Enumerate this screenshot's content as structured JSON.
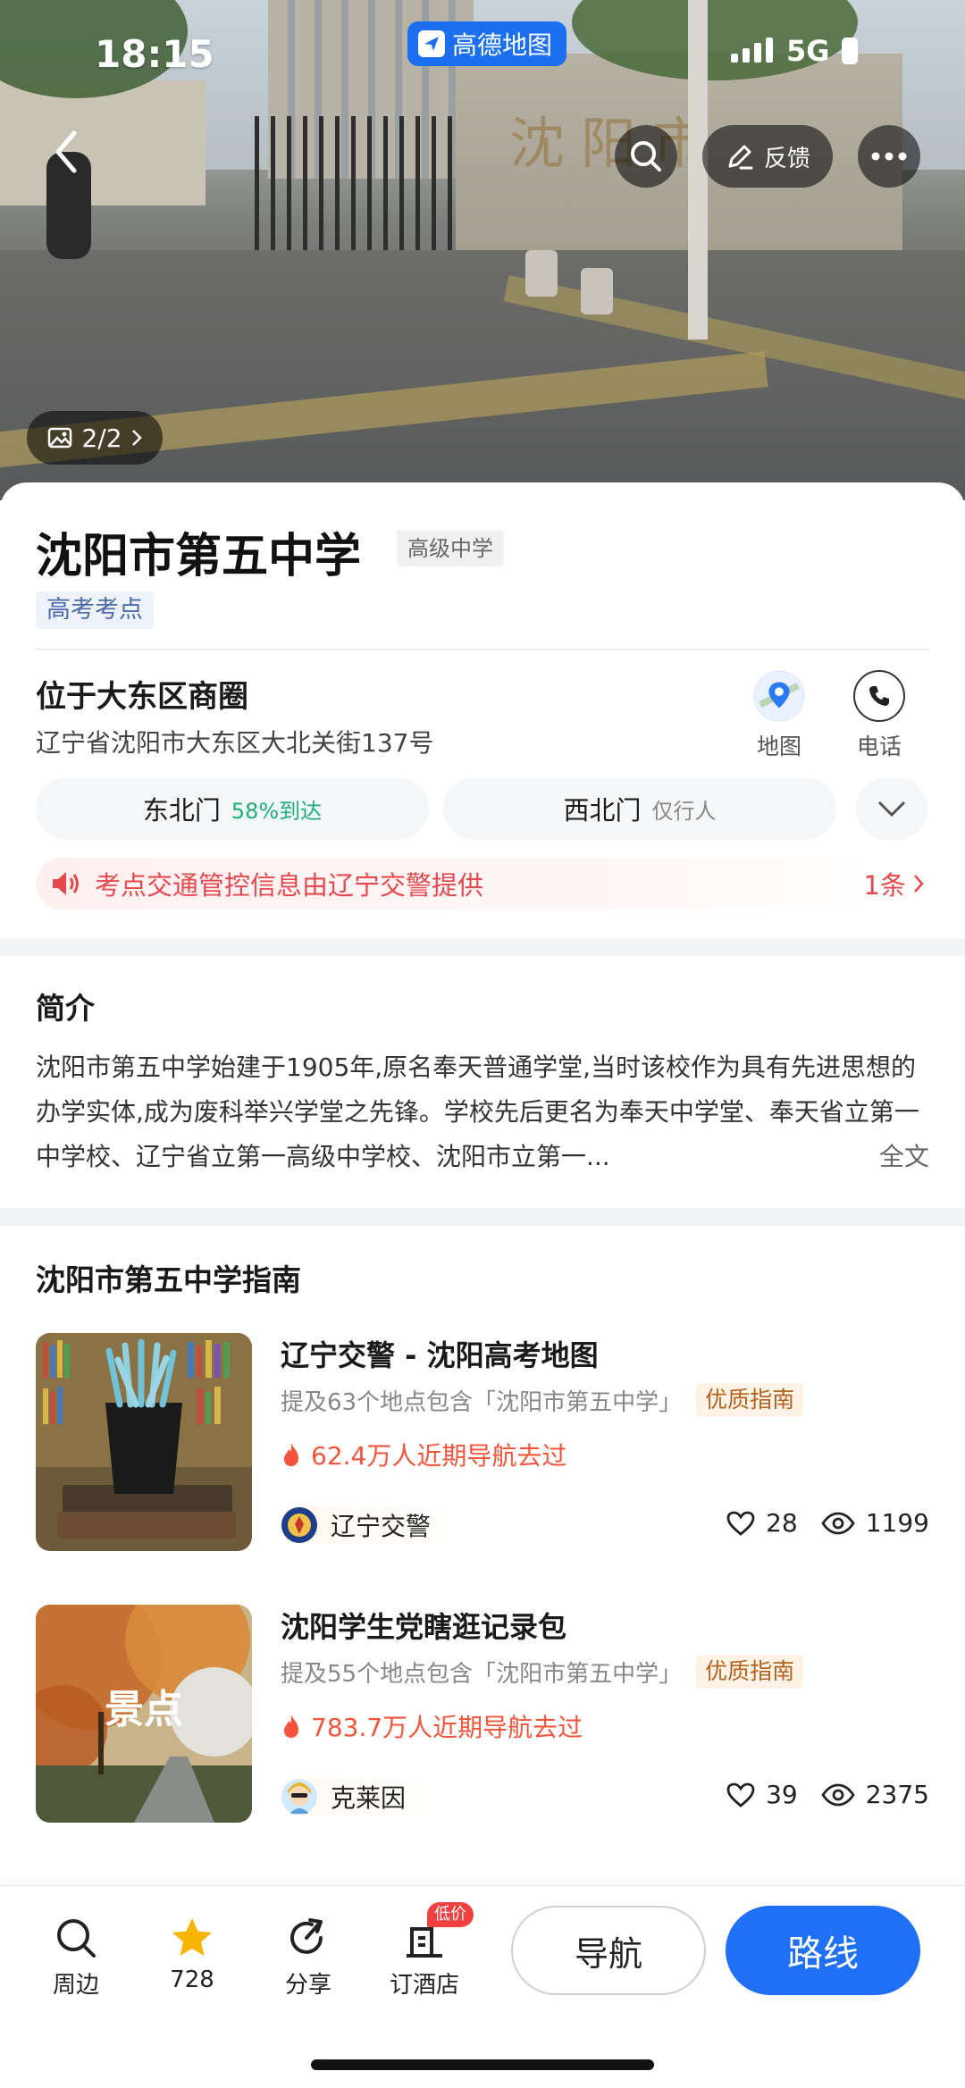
{
  "status_bar": {
    "time": "18:15",
    "network": "5G",
    "app_badge": "高德地图"
  },
  "hero": {
    "feedback_label": "反馈",
    "photo_count": "2/2",
    "sign_text": "沈阳市"
  },
  "poi": {
    "name": "沈阳市第五中学",
    "type_tag": "高级中学",
    "exam_tag": "高考考点",
    "area": "位于大东区商圈",
    "address": "辽宁省沈阳市大东区大北关街137号",
    "actions": [
      {
        "label": "地图",
        "icon": "map-pin-icon"
      },
      {
        "label": "电话",
        "icon": "phone-icon"
      }
    ],
    "gates": [
      {
        "name": "东北门",
        "note": "58%到达"
      },
      {
        "name": "西北门",
        "note": "仅行人"
      }
    ],
    "notice": {
      "text": "考点交通管控信息由辽宁交警提供",
      "count": "1条"
    }
  },
  "intro": {
    "title": "简介",
    "text": "沈阳市第五中学始建于1905年,原名奉天普通学堂,当时该校作为具有先进思想的办学实体,成为废科举兴学堂之先锋。学校先后更名为奉天中学堂、奉天省立第一中学校、辽宁省立第一高级中学校、沈阳市立第一...",
    "more": "全文"
  },
  "guides": {
    "title": "沈阳市第五中学指南",
    "items": [
      {
        "title": "辽宁交警 - 沈阳高考地图",
        "mention": "提及63个地点包含「沈阳市第五中学」",
        "quality": "优质指南",
        "hot": "62.4万人近期导航去过",
        "author": "辽宁交警",
        "likes": "28",
        "views": "1199",
        "thumb_label": ""
      },
      {
        "title": "沈阳学生党瞎逛记录包",
        "mention": "提及55个地点包含「沈阳市第五中学」",
        "quality": "优质指南",
        "hot": "783.7万人近期导航去过",
        "author": "克莱因",
        "likes": "39",
        "views": "2375",
        "thumb_label": "景点"
      }
    ]
  },
  "bottom_bar": {
    "tabs": [
      {
        "label": "周边",
        "icon": "search-icon"
      },
      {
        "label": "728",
        "icon": "star-icon"
      },
      {
        "label": "分享",
        "icon": "share-icon"
      },
      {
        "label": "订酒店",
        "icon": "hotel-icon",
        "badge": "低价"
      }
    ],
    "navigate": "导航",
    "route": "路线"
  },
  "colors": {
    "accent": "#1f6ff7",
    "alert": "#e5484d",
    "hot": "#f2553c",
    "star": "#f7b500"
  }
}
